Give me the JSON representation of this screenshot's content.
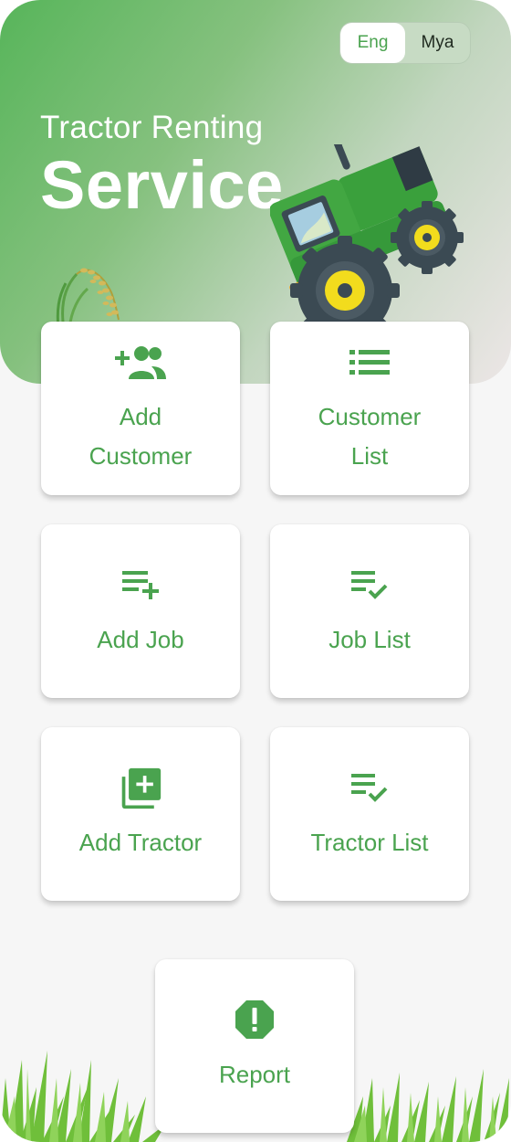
{
  "header": {
    "theme_icon": "moon-icon",
    "languages": [
      {
        "label": "Eng",
        "active": true
      },
      {
        "label": "Mya",
        "active": false
      }
    ],
    "title_small": "Tractor Renting",
    "title_big": "Service"
  },
  "menu": [
    {
      "label": "Add\nCustomer",
      "icon": "add-customer-icon"
    },
    {
      "label": "Customer\nList",
      "icon": "list-icon"
    },
    {
      "label": "Add Job",
      "icon": "playlist-add-icon"
    },
    {
      "label": "Job List",
      "icon": "playlist-check-icon"
    },
    {
      "label": "Add Tractor",
      "icon": "library-add-icon"
    },
    {
      "label": "Tractor List",
      "icon": "playlist-check-icon"
    },
    {
      "label": "Report",
      "icon": "report-icon"
    }
  ],
  "colors": {
    "accent": "#4aa34f",
    "hero_gradient_start": "#57b55a",
    "hero_gradient_end": "#ece6e6",
    "background": "#f6f6f6"
  }
}
